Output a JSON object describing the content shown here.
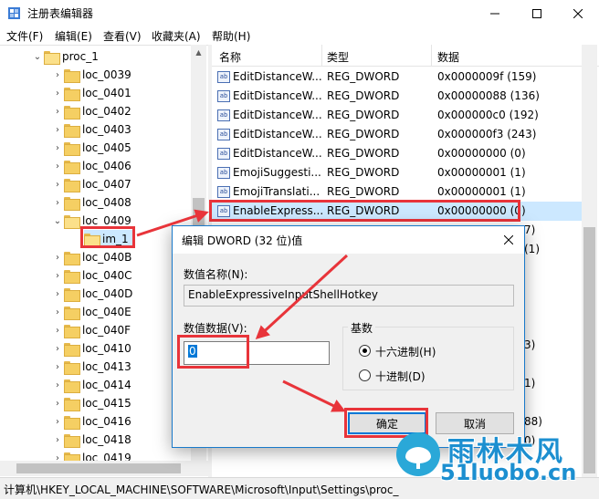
{
  "window": {
    "title": "注册表编辑器"
  },
  "menu": [
    "文件(F)",
    "编辑(E)",
    "查看(V)",
    "收藏夹(A)",
    "帮助(H)"
  ],
  "tree": {
    "parent": "proc_1",
    "items": [
      "loc_0039",
      "loc_0401",
      "loc_0402",
      "loc_0403",
      "loc_0405",
      "loc_0406",
      "loc_0407",
      "loc_0408",
      "loc_0409"
    ],
    "child": "im_1",
    "items_after": [
      "loc_040B",
      "loc_040C",
      "loc_040D",
      "loc_040E",
      "loc_040F",
      "loc_0410",
      "loc_0413",
      "loc_0414",
      "loc_0415",
      "loc_0416",
      "loc_0418",
      "loc_0419"
    ]
  },
  "list": {
    "headers": [
      "名称",
      "类型",
      "数据"
    ],
    "rows": [
      {
        "name": "EditDistanceW...",
        "type": "REG_DWORD",
        "data": "0x0000009f (159)"
      },
      {
        "name": "EditDistanceW...",
        "type": "REG_DWORD",
        "data": "0x00000088 (136)"
      },
      {
        "name": "EditDistanceW...",
        "type": "REG_DWORD",
        "data": "0x000000c0 (192)"
      },
      {
        "name": "EditDistanceW...",
        "type": "REG_DWORD",
        "data": "0x000000f3 (243)"
      },
      {
        "name": "EditDistanceW...",
        "type": "REG_DWORD",
        "data": "0x00000000 (0)"
      },
      {
        "name": "EmojiSuggesti...",
        "type": "REG_DWORD",
        "data": "0x00000001 (1)"
      },
      {
        "name": "EmojiTranslati...",
        "type": "REG_DWORD",
        "data": "0x00000001 (1)"
      },
      {
        "name": "EnableExpress...",
        "type": "REG_DWORD",
        "data": "0x00000000 (0)"
      }
    ],
    "partial_right": [
      "7)",
      "(1)",
      "3)",
      "1)",
      "88)",
      "0)"
    ]
  },
  "status": "计算机\\HKEY_LOCAL_MACHINE\\SOFTWARE\\Microsoft\\Input\\Settings\\proc_",
  "dialog": {
    "title": "编辑 DWORD (32 位)值",
    "name_label": "数值名称(N):",
    "name_value": "EnableExpressiveInputShellHotkey",
    "data_label": "数值数据(V):",
    "data_value": "0",
    "base_label": "基数",
    "radio_hex": "十六进制(H)",
    "radio_dec": "十进制(D)",
    "ok": "确定",
    "cancel": "取消"
  },
  "watermark": {
    "cn": "雨林木风",
    "en": "51luobo.cn"
  }
}
